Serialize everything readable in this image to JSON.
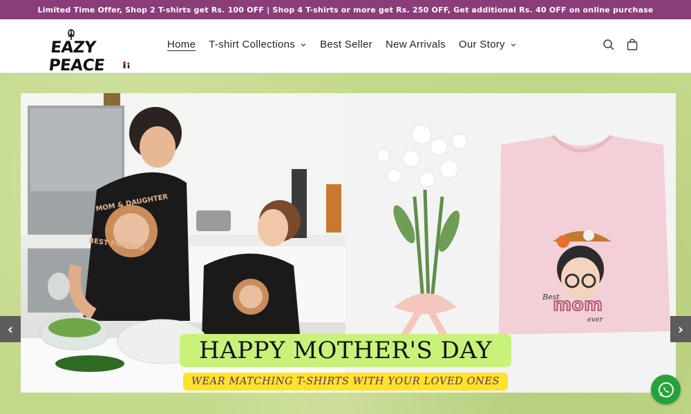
{
  "announcement": "Limited Time Offer, Shop 2 T-shirts get Rs. 100 OFF | Shop 4 T-shirts or more get Rs. 250 OFF, Get additional Rs. 40 OFF on online purchase",
  "logo": {
    "text": "EAZY PEACE"
  },
  "nav": [
    {
      "label": "Home",
      "active": true,
      "dropdown": false
    },
    {
      "label": "T-shirt Collections",
      "active": false,
      "dropdown": true
    },
    {
      "label": "Best Seller",
      "active": false,
      "dropdown": false
    },
    {
      "label": "New Arrivals",
      "active": false,
      "dropdown": false
    },
    {
      "label": "Our Story",
      "active": false,
      "dropdown": true
    }
  ],
  "header_icons": [
    "search-icon",
    "cart-icon"
  ],
  "hero": {
    "headline": "HAPPY MOTHER'S DAY",
    "subline": "WEAR MATCHING T-SHIRTS WITH YOUR LOVED ONES",
    "left_tee_text": [
      "MOM & DAUGHTER",
      "BEST FRIENDS"
    ],
    "right_tee_text": [
      "Best",
      "mom",
      "ever"
    ],
    "prev_arrow": "‹",
    "next_arrow": "›"
  },
  "colors": {
    "announcement_bg": "#8a3d78",
    "hero_bg": "#c3d98a",
    "headline_bg": "#c8f27a",
    "subline_bg": "#ffe22a",
    "whatsapp": "#24a33a"
  }
}
